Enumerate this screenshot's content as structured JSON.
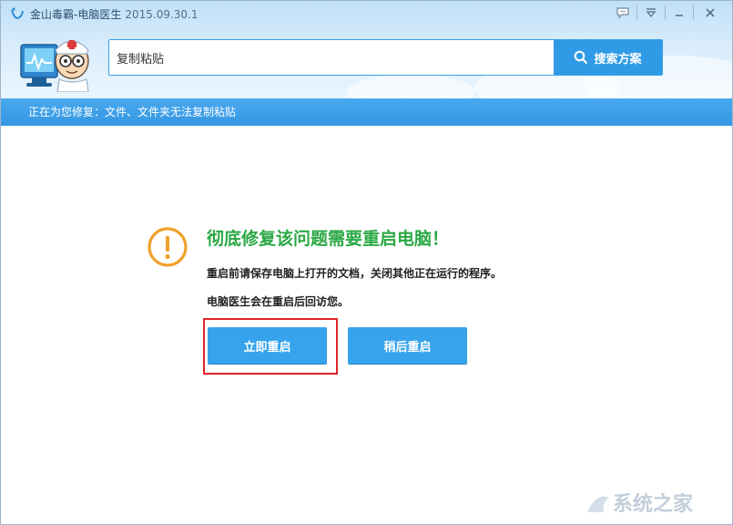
{
  "window": {
    "title": "金山毒霸-电脑医生",
    "version": "2015.09.30.1"
  },
  "icons": {
    "app_logo": "kingsoft-logo-icon",
    "feedback": "chat-bubble-icon",
    "menu": "dropdown-menu-icon",
    "minimize": "minimize-icon",
    "close": "close-icon",
    "search": "search-icon",
    "warning": "warning-circle-icon"
  },
  "search": {
    "value": "复制粘贴",
    "button_label": "搜索方案"
  },
  "status": {
    "text": "正在为您修复：文件、文件夹无法复制粘贴"
  },
  "dialog": {
    "headline": "彻底修复该问题需要重启电脑！",
    "line1": "重启前请保存电脑上打开的文档，关闭其他正在运行的程序。",
    "line2": "电脑医生会在重启后回访您。",
    "restart_now": "立即重启",
    "restart_later": "稍后重启"
  },
  "colors": {
    "accent": "#2f9be6",
    "headline": "#2aa844",
    "warning": "#f0a02a",
    "highlight": "#e0242a"
  },
  "watermark": {
    "text": "系统之家"
  }
}
